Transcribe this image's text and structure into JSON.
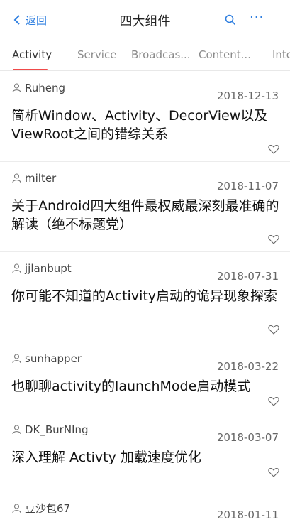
{
  "header": {
    "back_label": "返回",
    "title": "四大组件",
    "accent": "#2f7fe0"
  },
  "tabs": [
    {
      "label": "Activity",
      "active": true
    },
    {
      "label": "Service"
    },
    {
      "label": "Broadcas..."
    },
    {
      "label": "Content..."
    },
    {
      "label": "Inte"
    }
  ],
  "articles": [
    {
      "author": "Ruheng",
      "date": "2018-12-13",
      "title": "简析Window、Activity、DecorView以及ViewRoot之间的错综关系"
    },
    {
      "author": "milter",
      "date": "2018-11-07",
      "title": "关于Android四大组件最权威最深刻最准确的解读（绝不标题党）"
    },
    {
      "author": "jjlanbupt",
      "date": "2018-07-31",
      "title": "你可能不知道的Activity启动的诡异现象探索"
    },
    {
      "author": "sunhapper",
      "date": "2018-03-22",
      "title": "也聊聊activity的launchMode启动模式"
    },
    {
      "author": "DK_BurNIng",
      "date": "2018-03-07",
      "title": "深入理解 Activty 加载速度优化"
    },
    {
      "author": "豆沙包67",
      "date": "2018-01-11",
      "title": ""
    }
  ]
}
